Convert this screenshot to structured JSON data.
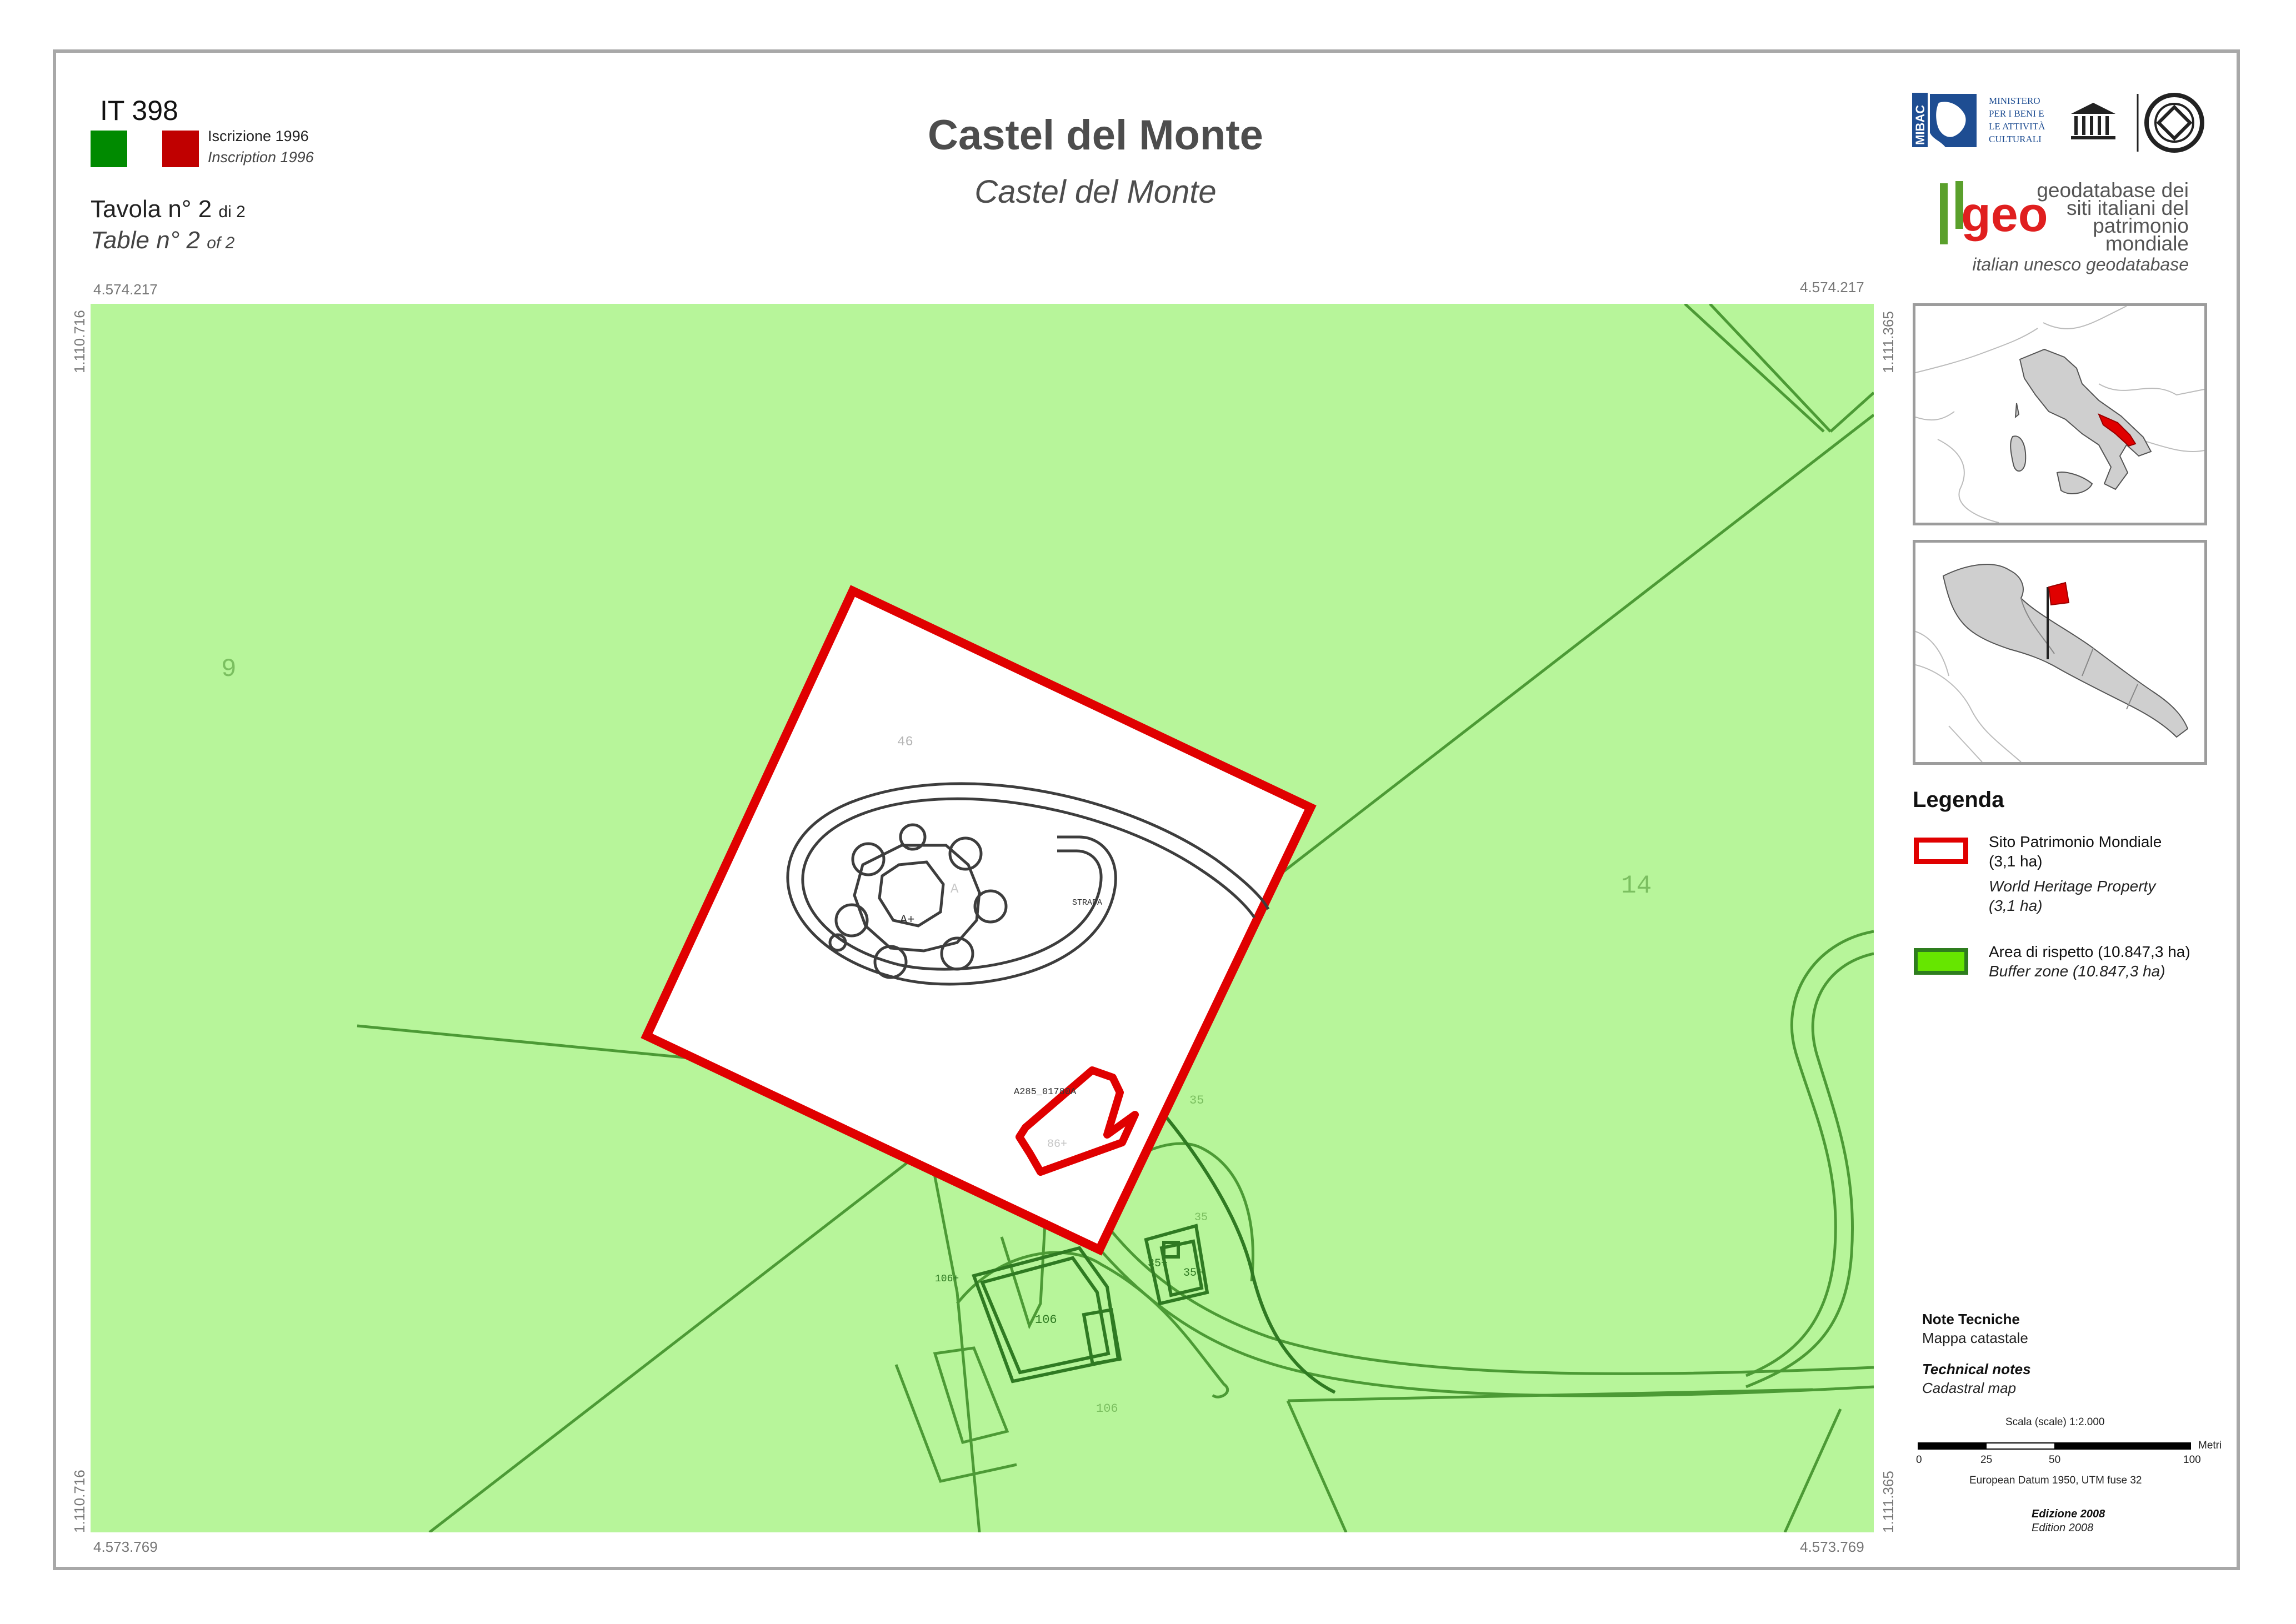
{
  "header": {
    "site_code": "IT 398",
    "inscription_it": "Iscrizione 1996",
    "inscription_en": "Inscription 1996",
    "colors": {
      "green_swatch": "#008a00",
      "red_swatch": "#c00000"
    },
    "tavola_prefix": "Tavola n° 2",
    "tavola_suffix": "di 2",
    "table_prefix": "Table n° 2",
    "table_suffix": "of 2",
    "title_it": "Castel del Monte",
    "title_en": "Castel del Monte"
  },
  "logos": {
    "mibac_vertical": "MIBAC",
    "ministero_lines": [
      "MINISTERO",
      "PER I BENI E",
      "LE ATTIVITÀ",
      "CULTURALI"
    ],
    "geo_brand": "geo",
    "geo_lines": [
      "geodatabase dei",
      "siti italiani del",
      "patrimonio",
      "mondiale"
    ],
    "geo_tagline": "italian unesco geodatabase",
    "icons": [
      "mibac-logo-icon",
      "unesco-temple-icon",
      "world-heritage-emblem-icon"
    ]
  },
  "map": {
    "coords": {
      "top_left": "4.574.217",
      "top_right": "4.574.217",
      "bottom_left": "4.573.769",
      "bottom_right": "4.573.769",
      "left_top": "1.110.716",
      "left_bottom": "1.110.716",
      "right_top": "1.111.365",
      "right_bottom": "1.111.365"
    },
    "parcel_labels": {
      "p9": "9",
      "p46": "46",
      "p14": "14",
      "pa": "A",
      "pap": "A+",
      "strada": "STRADA",
      "road_code": "A285_01780A",
      "p35": "35",
      "p35p": "35+",
      "p35p2": "35+",
      "p35c": "35",
      "p86": "86+",
      "p106p": "106+",
      "p106": "106",
      "p106b": "106"
    },
    "colors": {
      "buffer_fill": "#b7f59a",
      "buffer_line": "#4c9a35",
      "property_line": "#e00000",
      "outline": "#3d3d3d"
    }
  },
  "legend": {
    "title": "Legenda",
    "items": [
      {
        "label_it": "Sito Patrimonio Mondiale",
        "area_it": "(3,1 ha)",
        "label_en": "World Heritage Property",
        "area_en": "(3,1 ha)",
        "swatch_fill": "#ffffff",
        "swatch_border": "#e00000"
      },
      {
        "label_it": "Area di rispetto (10.847,3 ha)",
        "label_en": "Buffer zone (10.847,3 ha)",
        "swatch_fill": "#66e600",
        "swatch_border": "#2e7d1e"
      }
    ]
  },
  "notes": {
    "heading_it": "Note Tecniche",
    "text_it": "Mappa catastale",
    "heading_en": "Technical notes",
    "text_en": "Cadastral map"
  },
  "scale": {
    "title": "Scala (scale) 1:2.000",
    "unit": "Metri",
    "ticks": [
      "0",
      "25",
      "50",
      "100"
    ],
    "datum": "European Datum 1950, UTM fuse 32"
  },
  "edition": {
    "it": "Edizione 2008",
    "en": "Edition 2008"
  }
}
